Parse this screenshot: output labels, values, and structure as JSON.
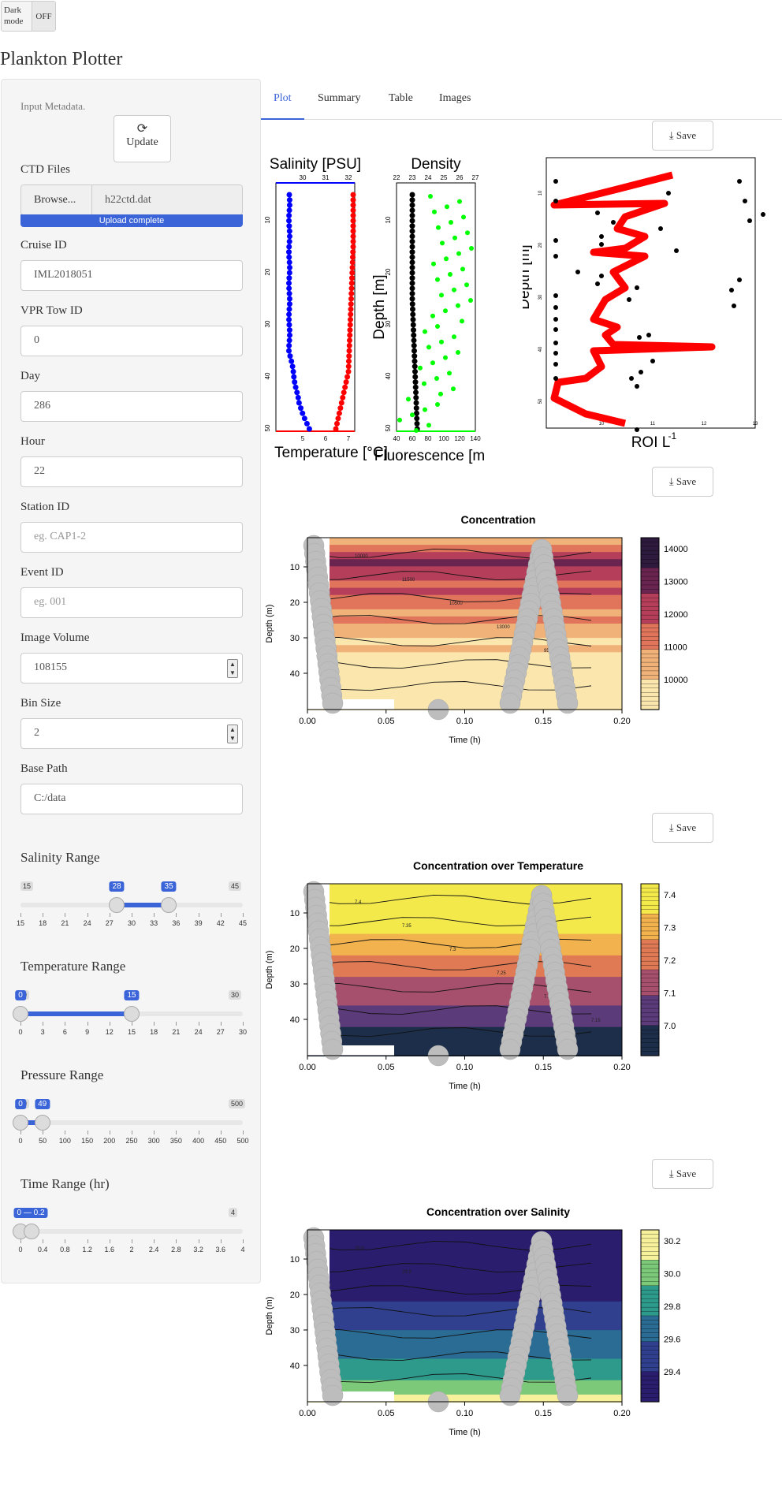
{
  "toggle": {
    "label": "Dark mode",
    "state": "OFF"
  },
  "app": {
    "title": "Plankton Plotter"
  },
  "sidebar": {
    "metadata_label": "Input Metadata.",
    "update_label": "Update",
    "ctd_label": "CTD Files",
    "browse_label": "Browse...",
    "file_name": "h22ctd.dat",
    "upload_status": "Upload complete",
    "cruise_label": "Cruise ID",
    "cruise_value": "IML2018051",
    "tow_label": "VPR Tow ID",
    "tow_value": "0",
    "day_label": "Day",
    "day_value": "286",
    "hour_label": "Hour",
    "hour_value": "22",
    "station_label": "Station ID",
    "station_placeholder": "eg. CAP1-2",
    "event_label": "Event ID",
    "event_placeholder": "eg. 001",
    "volume_label": "Image Volume",
    "volume_value": "108155",
    "bin_label": "Bin Size",
    "bin_value": "2",
    "path_label": "Base Path",
    "path_value": "C:/data"
  },
  "ranges": {
    "salinity": {
      "title": "Salinity Range",
      "min": "15",
      "max": "45",
      "from": "28",
      "to": "35",
      "ticks": [
        "15",
        "18",
        "21",
        "24",
        "27",
        "30",
        "33",
        "36",
        "39",
        "42",
        "45"
      ],
      "from_frac": 0.433,
      "to_frac": 0.667
    },
    "temperature": {
      "title": "Temperature Range",
      "min": "0",
      "max": "30",
      "from": "0",
      "to": "15",
      "ticks": [
        "0",
        "3",
        "6",
        "9",
        "12",
        "15",
        "18",
        "21",
        "24",
        "27",
        "30"
      ],
      "from_frac": 0.0,
      "to_frac": 0.5
    },
    "pressure": {
      "title": "Pressure Range",
      "min": "0",
      "max": "500",
      "from": "0",
      "to": "49",
      "ticks": [
        "0",
        "50",
        "100",
        "150",
        "200",
        "250",
        "300",
        "350",
        "400",
        "450",
        "500"
      ],
      "from_frac": 0.0,
      "to_frac": 0.098
    },
    "time": {
      "title": "Time Range (hr)",
      "min": "0",
      "max": "4",
      "value": "0 — 0.2",
      "ticks": [
        "0",
        "0.4",
        "0.8",
        "1.2",
        "1.6",
        "2",
        "2.4",
        "2.8",
        "3.2",
        "3.6",
        "4"
      ],
      "from_frac": 0.0,
      "to_frac": 0.05
    }
  },
  "tabs": [
    {
      "label": "Plot"
    },
    {
      "label": "Summary"
    },
    {
      "label": "Table"
    },
    {
      "label": "Images"
    }
  ],
  "save_label": "Save",
  "colors": {
    "accent": "#3a64d8",
    "salinity": "#0000ff",
    "temperature": "#ff0000",
    "density": "#000000",
    "fluorescence": "#00ff00",
    "roi": "#ff0000"
  },
  "profiles": {
    "salinity_title": "Salinity [PSU]",
    "density_title": "Density",
    "depth_label": "Depth [m]",
    "temperature_label": "Temperature [°C]",
    "fluorescence_label": "Fluorescence [m",
    "roi_label": "ROI L",
    "roi_superscript": "-1",
    "sal_ticks": [
      "30",
      "31",
      "32"
    ],
    "temp_ticks": [
      "5",
      "6",
      "7"
    ],
    "dens_ticks": [
      "22",
      "23",
      "24",
      "25",
      "26",
      "27"
    ],
    "fluo_ticks": [
      "40",
      "60",
      "80",
      "100",
      "120",
      "140"
    ],
    "depth_ticks": [
      "10",
      "20",
      "30",
      "40",
      "50"
    ],
    "roi_ticks": [
      "10",
      "11",
      "12",
      "13"
    ]
  },
  "chart_data": [
    {
      "type": "heatmap",
      "title": "Concentration",
      "xlabel": "Time (h)",
      "ylabel": "Depth (m)",
      "xlim": [
        0,
        0.2
      ],
      "ylim": [
        48,
        2
      ],
      "x_ticks": [
        "0.00",
        "0.05",
        "0.10",
        "0.15",
        "0.20"
      ],
      "y_ticks": [
        "10",
        "20",
        "30",
        "40"
      ],
      "colorbar_ticks": [
        "14000",
        "13000",
        "12000",
        "11000",
        "10000"
      ],
      "colorbar": [
        "#2d1a3d",
        "#6a2450",
        "#b53f5a",
        "#e0755c",
        "#f0b279",
        "#fbe7ad"
      ],
      "contour_labels": [
        "10000",
        "11500",
        "10500",
        "13000",
        "9500"
      ]
    },
    {
      "type": "heatmap",
      "title": "Concentration over Temperature",
      "xlabel": "Time (h)",
      "ylabel": "Depth (m)",
      "xlim": [
        0,
        0.2
      ],
      "ylim": [
        48,
        2
      ],
      "x_ticks": [
        "0.00",
        "0.05",
        "0.10",
        "0.15",
        "0.20"
      ],
      "y_ticks": [
        "10",
        "20",
        "30",
        "40"
      ],
      "colorbar_ticks": [
        "7.4",
        "7.3",
        "7.2",
        "7.1",
        "7.0"
      ],
      "colorbar": [
        "#f3e94b",
        "#f2b24d",
        "#e07a55",
        "#a6506e",
        "#5c3b7a",
        "#1c2e4a"
      ],
      "contour_labels": [
        "7.4",
        "7.35",
        "7.3",
        "7.25",
        "7.2",
        "7.15"
      ]
    },
    {
      "type": "heatmap",
      "title": "Concentration over Salinity",
      "xlabel": "Time (h)",
      "ylabel": "Depth (m)",
      "xlim": [
        0,
        0.2
      ],
      "ylim": [
        48,
        2
      ],
      "x_ticks": [
        "0.00",
        "0.05",
        "0.10",
        "0.15",
        "0.20"
      ],
      "y_ticks": [
        "10",
        "20",
        "30",
        "40"
      ],
      "colorbar_ticks": [
        "30.2",
        "30.0",
        "29.8",
        "29.6",
        "29.4"
      ],
      "colorbar": [
        "#f6f19a",
        "#7cc97a",
        "#2d9a8c",
        "#2a6c93",
        "#30408e",
        "#2a1d6e"
      ],
      "contour_labels": [
        "29.8",
        "29.9"
      ]
    }
  ]
}
